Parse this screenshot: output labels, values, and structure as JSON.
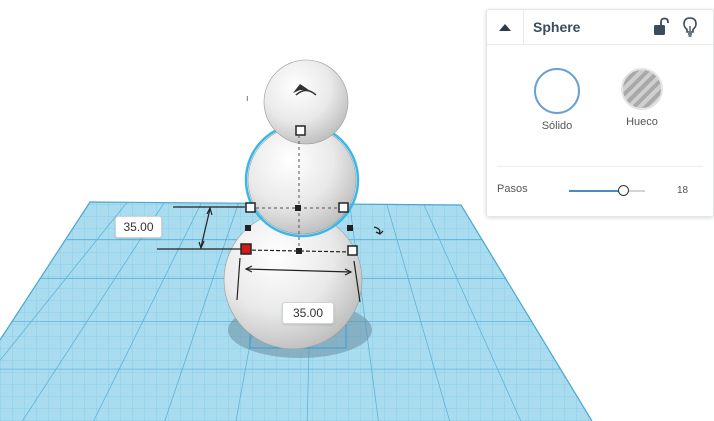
{
  "workplane": {
    "grid_color": "#8fd0ea",
    "line_color": "#5fb3d8"
  },
  "dimensions": {
    "height_value": "35.00",
    "width_value": "35.00"
  },
  "inspector": {
    "title": "Sphere",
    "collapse_icon": "triangle-up-icon",
    "lock_icon": "unlock-icon",
    "bulb_icon": "lightbulb-icon",
    "solid_label": "Sólido",
    "hole_label": "Hueco",
    "steps_label": "Pasos",
    "steps_value": "18",
    "steps_level": 0.71,
    "accent": "#6b9fd1"
  }
}
